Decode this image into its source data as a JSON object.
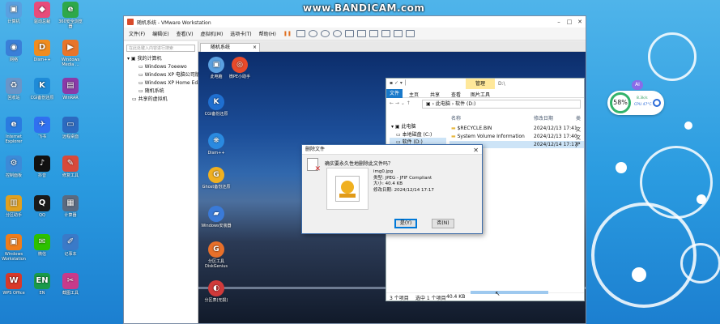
{
  "watermark": "www.BANDICAM.com",
  "desktop_icons": [
    {
      "label": "计算机",
      "color": "#5aa0e0",
      "glyph": "▣"
    },
    {
      "label": "驱动总裁",
      "color": "#e84b7a",
      "glyph": "◆"
    },
    {
      "label": "360安全浏览器",
      "color": "#2ea84a",
      "glyph": "e"
    },
    {
      "label": "网络",
      "color": "#3a7fd8",
      "glyph": "◉"
    },
    {
      "label": "Dism++",
      "color": "#f08c1e",
      "glyph": "D"
    },
    {
      "label": "Windows Media ...",
      "color": "#e8752a",
      "glyph": "▶"
    },
    {
      "label": "回收站",
      "color": "#6a95c8",
      "glyph": "♻"
    },
    {
      "label": "CGI备份还原",
      "color": "#1f8bd8",
      "glyph": "K"
    },
    {
      "label": "WinRAR",
      "color": "#8a3aa8",
      "glyph": "▤"
    },
    {
      "label": "Internet Explorer",
      "color": "#2a7be0",
      "glyph": "e"
    },
    {
      "label": "飞书",
      "color": "#3070f0",
      "glyph": "✈"
    },
    {
      "label": "远程桌面",
      "color": "#2c6ac0",
      "glyph": "▭"
    },
    {
      "label": "控制面板",
      "color": "#3c8ad8",
      "glyph": "⚙"
    },
    {
      "label": "抖音",
      "color": "#111111",
      "glyph": "♪"
    },
    {
      "label": "修复工具",
      "color": "#d84a3a",
      "glyph": "✎"
    },
    {
      "label": "分区助手",
      "color": "#e0a020",
      "glyph": "▥"
    },
    {
      "label": "QQ",
      "color": "#1a1a1a",
      "glyph": "Q"
    },
    {
      "label": "计算器",
      "color": "#5a6a80",
      "glyph": "▦"
    },
    {
      "label": "Windows Workstation",
      "color": "#ef7d1c",
      "glyph": "▣"
    },
    {
      "label": "微信",
      "color": "#2dc100",
      "glyph": "✉"
    },
    {
      "label": "记事本",
      "color": "#3a7ac8",
      "glyph": "✐"
    },
    {
      "label": "WPS Office",
      "color": "#d8382a",
      "glyph": "W"
    },
    {
      "label": "EN",
      "color": "#1a9a4a",
      "glyph": "EN"
    },
    {
      "label": "截图工具",
      "color": "#c83a8a",
      "glyph": "✂"
    }
  ],
  "vmware": {
    "title": "随机系统 - VMware Workstation",
    "menu": [
      "文件(F)",
      "编辑(E)",
      "查看(V)",
      "虚拟机(M)",
      "选项卡(T)",
      "帮助(H)"
    ],
    "library_search": "在此处键入内容进行搜索",
    "tree": [
      "我的计算机",
      "Windows 7oeewo",
      "Windows XP 电脑公司版",
      "Windows XP Home Ed...",
      "随机系统",
      "共享的虚拟机"
    ],
    "tab": "随机系统",
    "guest_icons": [
      {
        "label": "此电脑",
        "color": "#5aa0e0",
        "glyph": "▣"
      },
      {
        "label": "微PE小助手",
        "color": "#e84a2a",
        "glyph": "◎"
      },
      {
        "label": "CGI备份还原",
        "color": "#1f6fd0",
        "glyph": "K"
      },
      {
        "label": "Dism++",
        "color": "#2a8ae0",
        "glyph": "❋"
      },
      {
        "label": "Ghost备份还原",
        "color": "#f0b020",
        "glyph": "G"
      },
      {
        "label": "Windows安装器",
        "color": "#3a7ad8",
        "glyph": "▰"
      },
      {
        "label": "分区工具 DiskGenius",
        "color": "#e8702a",
        "glyph": "G"
      },
      {
        "label": "分区表(无损)",
        "color": "#d03a3a",
        "glyph": "◐"
      }
    ]
  },
  "explorer": {
    "ribbon_tabs": [
      "文件",
      "主页",
      "共享",
      "查看",
      "图片工具"
    ],
    "context_tab": "管理",
    "context_label": "D:\\",
    "address": [
      "此电脑",
      "软件 (D:)"
    ],
    "col_name": "名称",
    "col_date": "修改日期",
    "col_extra": "类",
    "nav": [
      "此电脑",
      "本地磁盘 (C:)",
      "软件 (D:)"
    ],
    "files": [
      {
        "name": "$RECYCLE.BIN",
        "date": "2024/12/13 17:41",
        "type": "文"
      },
      {
        "name": "System Volume Information",
        "date": "2024/12/13 17:40",
        "type": "文"
      },
      {
        "name": "",
        "date": "2024/12/14 17:17",
        "type": "JP"
      }
    ],
    "status": [
      "3 个项目",
      "选中 1 个项目",
      "40.4 KB"
    ]
  },
  "dialog": {
    "title": "删除文件",
    "question": "确实要永久性地删除此文件吗？",
    "filename": "img0.jpg",
    "type": "类型: JPEG - JFIF Compliant",
    "size": "大小: 40.4 KB",
    "date": "修改日期: 2024/12/14 17:17",
    "yes": "是(Y)",
    "no": "否(N)"
  },
  "widget": {
    "ai": "AI",
    "percent": "58%",
    "speed": "8.3k/s",
    "cpu": "CPU 47°C"
  }
}
